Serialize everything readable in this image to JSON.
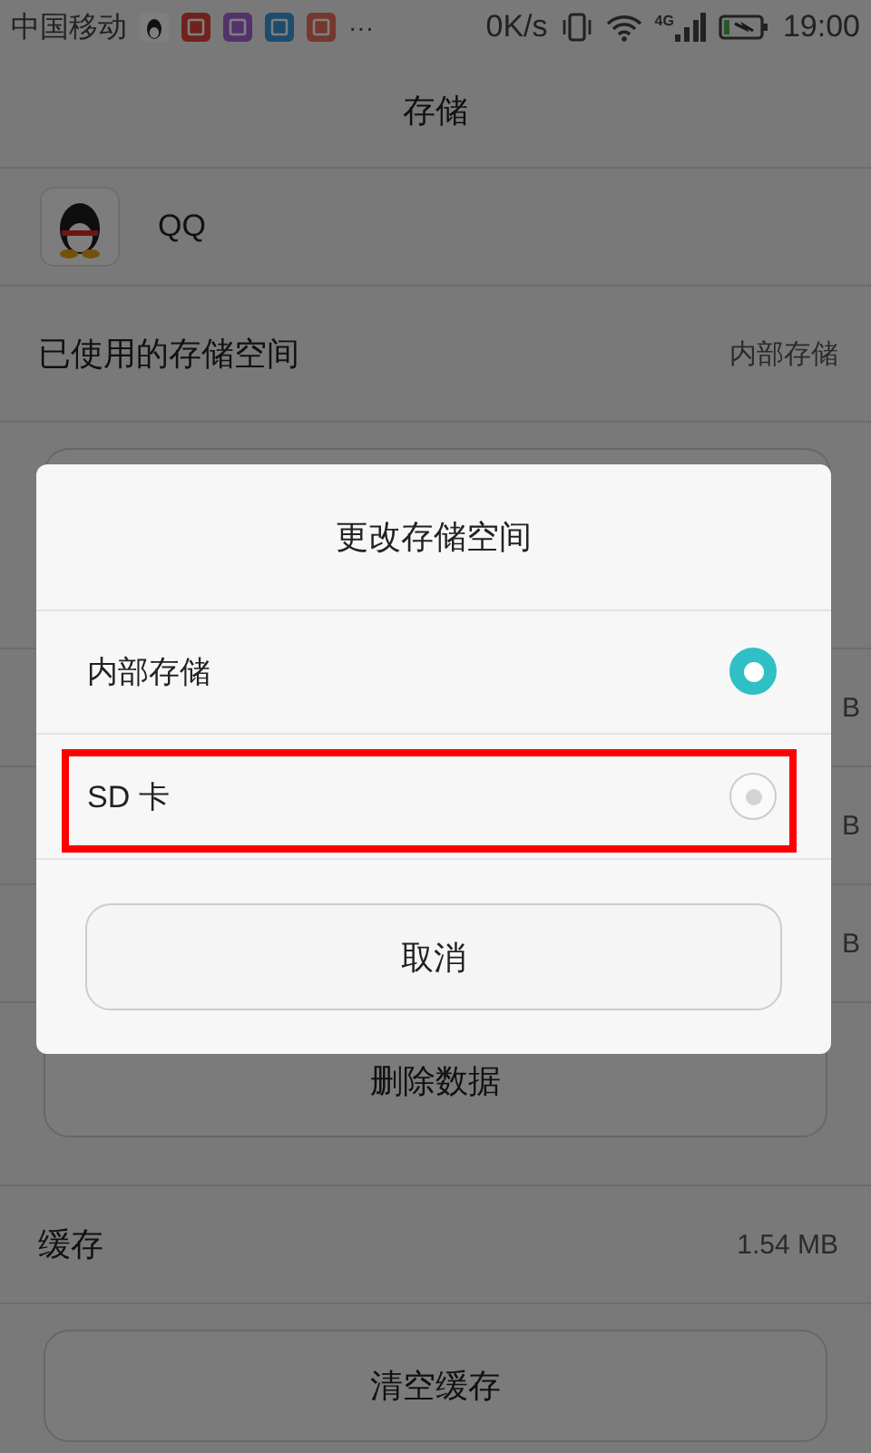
{
  "status_bar": {
    "carrier": "中国移动",
    "more": "···",
    "speed": "0K/s",
    "network": "4G",
    "time": "19:00"
  },
  "title": "存储",
  "app": {
    "name": "QQ"
  },
  "storage_used": {
    "label": "已使用的存储空间",
    "value": "内部存储"
  },
  "partial_rows": [
    {
      "value": "B"
    },
    {
      "value": "B"
    },
    {
      "value": "B"
    }
  ],
  "delete_data_button": "删除数据",
  "cache": {
    "label": "缓存",
    "value": "1.54 MB"
  },
  "clear_cache_button": "清空缓存",
  "dialog": {
    "title": "更改存储空间",
    "options": [
      {
        "label": "内部存储",
        "selected": true,
        "highlighted": false
      },
      {
        "label": "SD 卡",
        "selected": false,
        "highlighted": true
      }
    ],
    "cancel": "取消"
  }
}
